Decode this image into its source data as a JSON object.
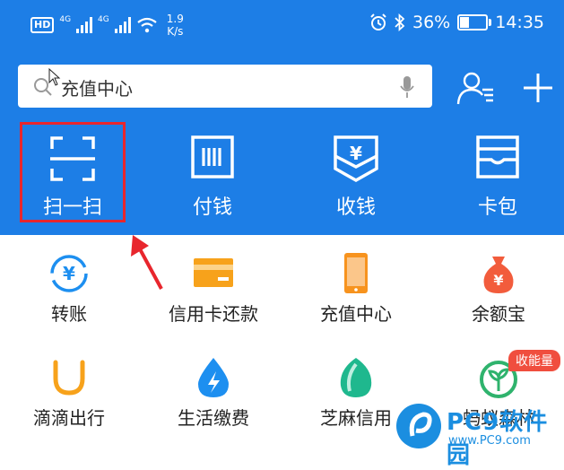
{
  "status_bar": {
    "hd_label": "HD",
    "signal1_label": "4G",
    "signal2_label": "4G",
    "speed_value": "1.9",
    "speed_unit": "K/s",
    "battery_percent": "36%",
    "battery_level": 0.36,
    "time": "14:35"
  },
  "search": {
    "text": "充值中心"
  },
  "top_tools": [
    {
      "label": "扫一扫",
      "icon": "scan-icon"
    },
    {
      "label": "付钱",
      "icon": "barcode-pay-icon"
    },
    {
      "label": "收钱",
      "icon": "receive-money-icon"
    },
    {
      "label": "卡包",
      "icon": "card-wallet-icon"
    }
  ],
  "services": [
    {
      "label": "转账",
      "icon": "transfer-icon",
      "color": "#1d8ff0"
    },
    {
      "label": "信用卡还款",
      "icon": "credit-card-icon",
      "color": "#f7a21b"
    },
    {
      "label": "充值中心",
      "icon": "phone-icon",
      "color": "#f7931e"
    },
    {
      "label": "余额宝",
      "icon": "money-bag-icon",
      "color": "#f25c3c"
    },
    {
      "label": "滴滴出行",
      "icon": "didi-icon",
      "color": "#f7a21b"
    },
    {
      "label": "生活缴费",
      "icon": "utility-drop-icon",
      "color": "#1d8ff0"
    },
    {
      "label": "芝麻信用",
      "icon": "sesame-icon",
      "color": "#1fb88e"
    },
    {
      "label": "蚂蚁森林",
      "icon": "ant-forest-icon",
      "color": "#2fb36d",
      "badge": "收能量"
    }
  ],
  "watermark": {
    "title": "PC9软件园",
    "url": "www.PC9.com"
  },
  "colors": {
    "primary_blue": "#1d7ee6",
    "highlight_red": "#e8262d"
  }
}
